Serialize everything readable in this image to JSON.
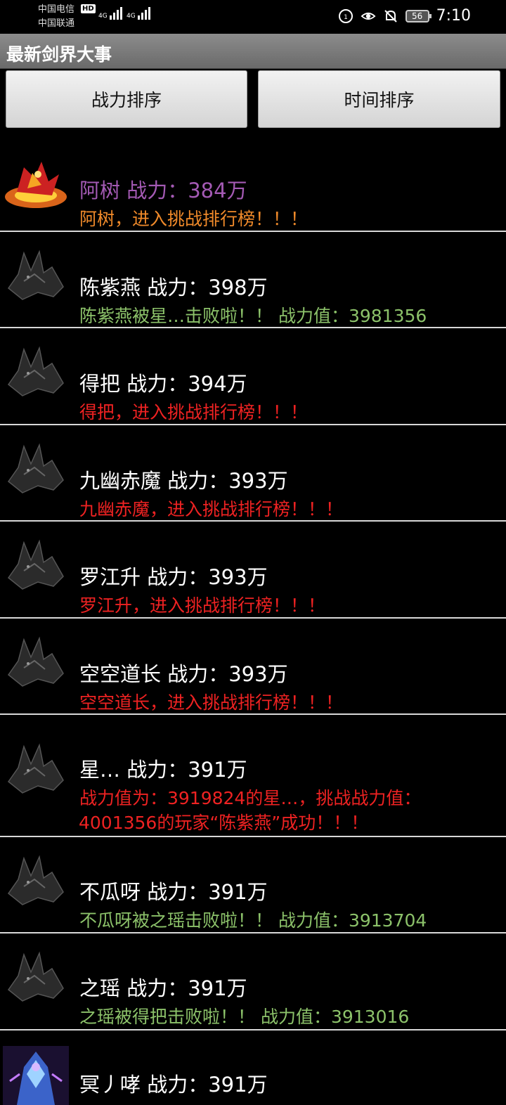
{
  "status_bar": {
    "carrier_1": "中国电信",
    "carrier_2": "中国联通",
    "hd_badge": "HD",
    "net_1": "4G",
    "net_2": "4G",
    "battery": "56",
    "time": "7:10"
  },
  "header": {
    "title": "最新剑界大事"
  },
  "sort_buttons": {
    "power_label": "战力排序",
    "time_label": "时间排序"
  },
  "entries": [
    {
      "name_power": "阿树 战力：384万",
      "message": "阿树，进入挑战排行榜！！！",
      "name_color": "#a45ab4",
      "message_color": "#f08a2a",
      "avatar": "fire-creature-avatar"
    },
    {
      "name_power": "陈紫燕 战力：398万",
      "message": "陈紫燕被星…击败啦！！ 战力值：3981356",
      "name_color": "#ffffff",
      "message_color": "#8cc26a",
      "avatar": "dark-beast-avatar"
    },
    {
      "name_power": "得把 战力：394万",
      "message": "得把，进入挑战排行榜！！！",
      "name_color": "#ffffff",
      "message_color": "#ee2222",
      "avatar": "dark-beast-avatar"
    },
    {
      "name_power": "九幽赤魔 战力：393万",
      "message": "九幽赤魔，进入挑战排行榜！！！",
      "name_color": "#ffffff",
      "message_color": "#ee2222",
      "avatar": "dark-beast-avatar"
    },
    {
      "name_power": "罗江升 战力：393万",
      "message": "罗江升，进入挑战排行榜！！！",
      "name_color": "#ffffff",
      "message_color": "#ee2222",
      "avatar": "dark-beast-avatar"
    },
    {
      "name_power": "空空道长 战力：393万",
      "message": "空空道长，进入挑战排行榜！！！",
      "name_color": "#ffffff",
      "message_color": "#ee2222",
      "avatar": "dark-beast-avatar"
    },
    {
      "name_power": "星… 战力：391万",
      "message": "战力值为：3919824的星…，挑战战力值：",
      "message_2": "4001356的玩家“陈紫燕”成功！！！",
      "name_color": "#ffffff",
      "message_color": "#ee2222",
      "avatar": "dark-beast-avatar"
    },
    {
      "name_power": "不瓜呀 战力：391万",
      "message": "不瓜呀被之瑶击败啦！！ 战力值：3913704",
      "name_color": "#ffffff",
      "message_color": "#8cc26a",
      "avatar": "dark-beast-avatar"
    },
    {
      "name_power": "之瑶 战力：391万",
      "message": "之瑶被得把击败啦！！ 战力值：3913016",
      "name_color": "#ffffff",
      "message_color": "#8cc26a",
      "avatar": "dark-beast-avatar"
    },
    {
      "name_power": "冥丿哮 战力：391万",
      "message": "",
      "name_color": "#ffffff",
      "message_color": "#ee2222",
      "avatar": "crystal-mage-avatar"
    }
  ]
}
